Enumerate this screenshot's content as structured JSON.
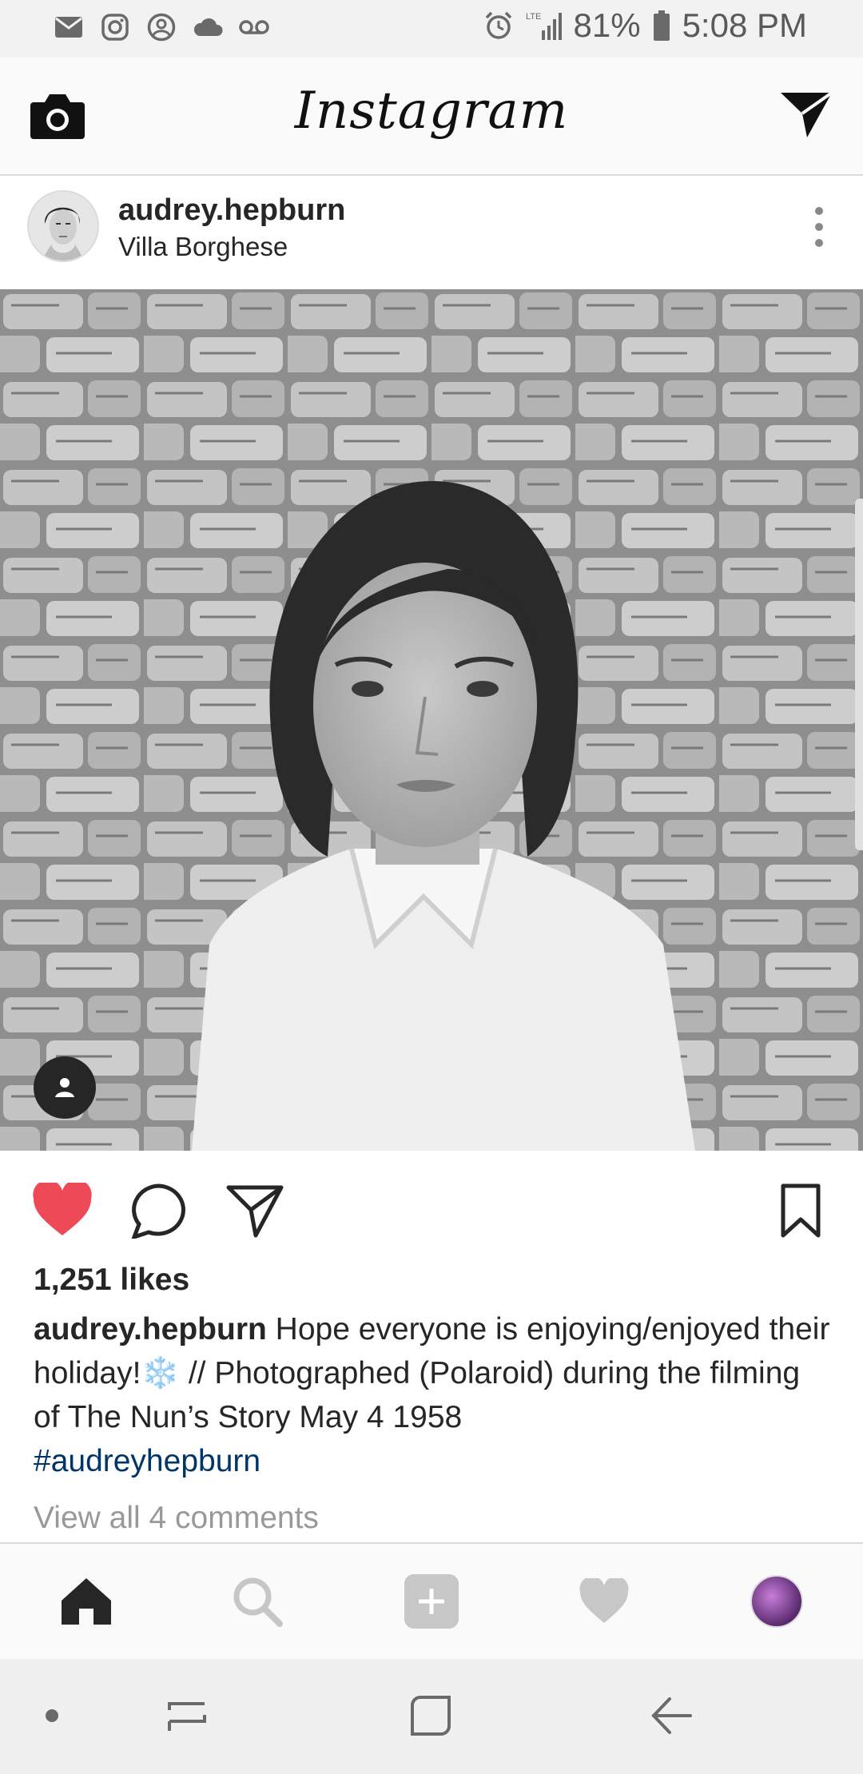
{
  "status_bar": {
    "battery": "81%",
    "time": "5:08 PM",
    "network": "LTE",
    "icons": [
      "mail-icon",
      "instagram-icon",
      "account-circle-icon",
      "cloud-icon",
      "voicemail-icon",
      "alarm-icon",
      "signal-icon",
      "battery-icon"
    ]
  },
  "app_bar": {
    "title": "Instagram",
    "left_icon": "camera-icon",
    "right_icon": "direct-message-icon"
  },
  "post": {
    "username": "audrey.hepburn",
    "location": "Villa Borghese",
    "likes": "1,251 likes",
    "caption_user": "audrey.hepburn",
    "caption_text": " Hope everyone is enjoying/enjoyed their holiday!❄️ // Photographed (Polaroid) during the filming of The Nun’s Story May 4 1958",
    "hashtag": "#audreyhepburn",
    "view_comments": "View all 4 comments",
    "liked": true
  },
  "bottom_nav": {
    "items": [
      "home-icon",
      "search-icon",
      "add-post-icon",
      "activity-heart-icon",
      "profile-avatar"
    ]
  },
  "colors": {
    "like_red": "#ED4956",
    "hashtag_blue": "#003569",
    "muted_gray": "#999999"
  }
}
